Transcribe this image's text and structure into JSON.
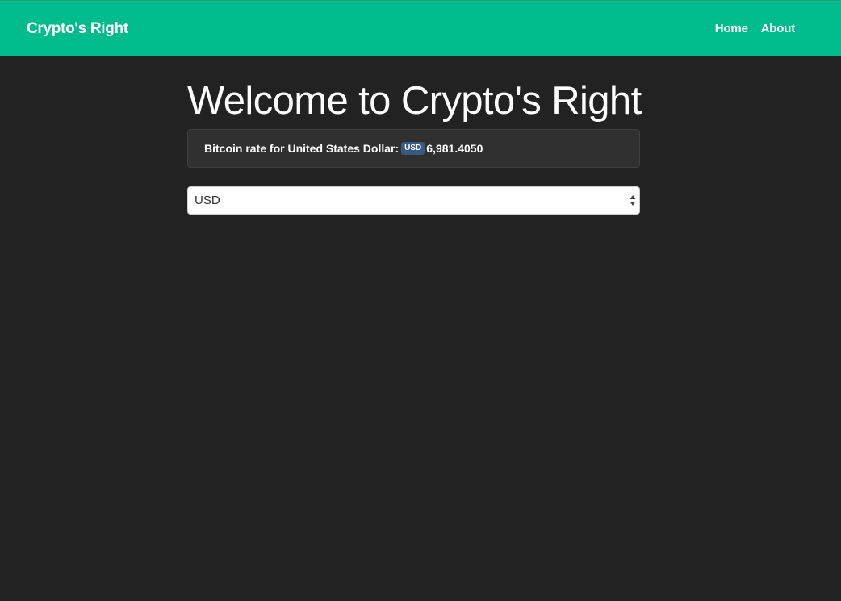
{
  "navbar": {
    "brand": "Crypto's Right",
    "links": [
      "Home",
      "About"
    ],
    "background": "#00bc8c"
  },
  "main": {
    "title": "Welcome to Crypto's Right",
    "rate": {
      "label": "Bitcoin rate for United States Dollar:",
      "currency_badge": "USD",
      "value": "6,981.4050"
    },
    "currency_select": {
      "selected": "USD"
    }
  },
  "colors": {
    "page_background": "#222222",
    "accent": "#00bc8c",
    "badge": "#375a7f",
    "well": "#303030"
  },
  "icons": {
    "select_arrows": "up-down-caret-icon"
  }
}
